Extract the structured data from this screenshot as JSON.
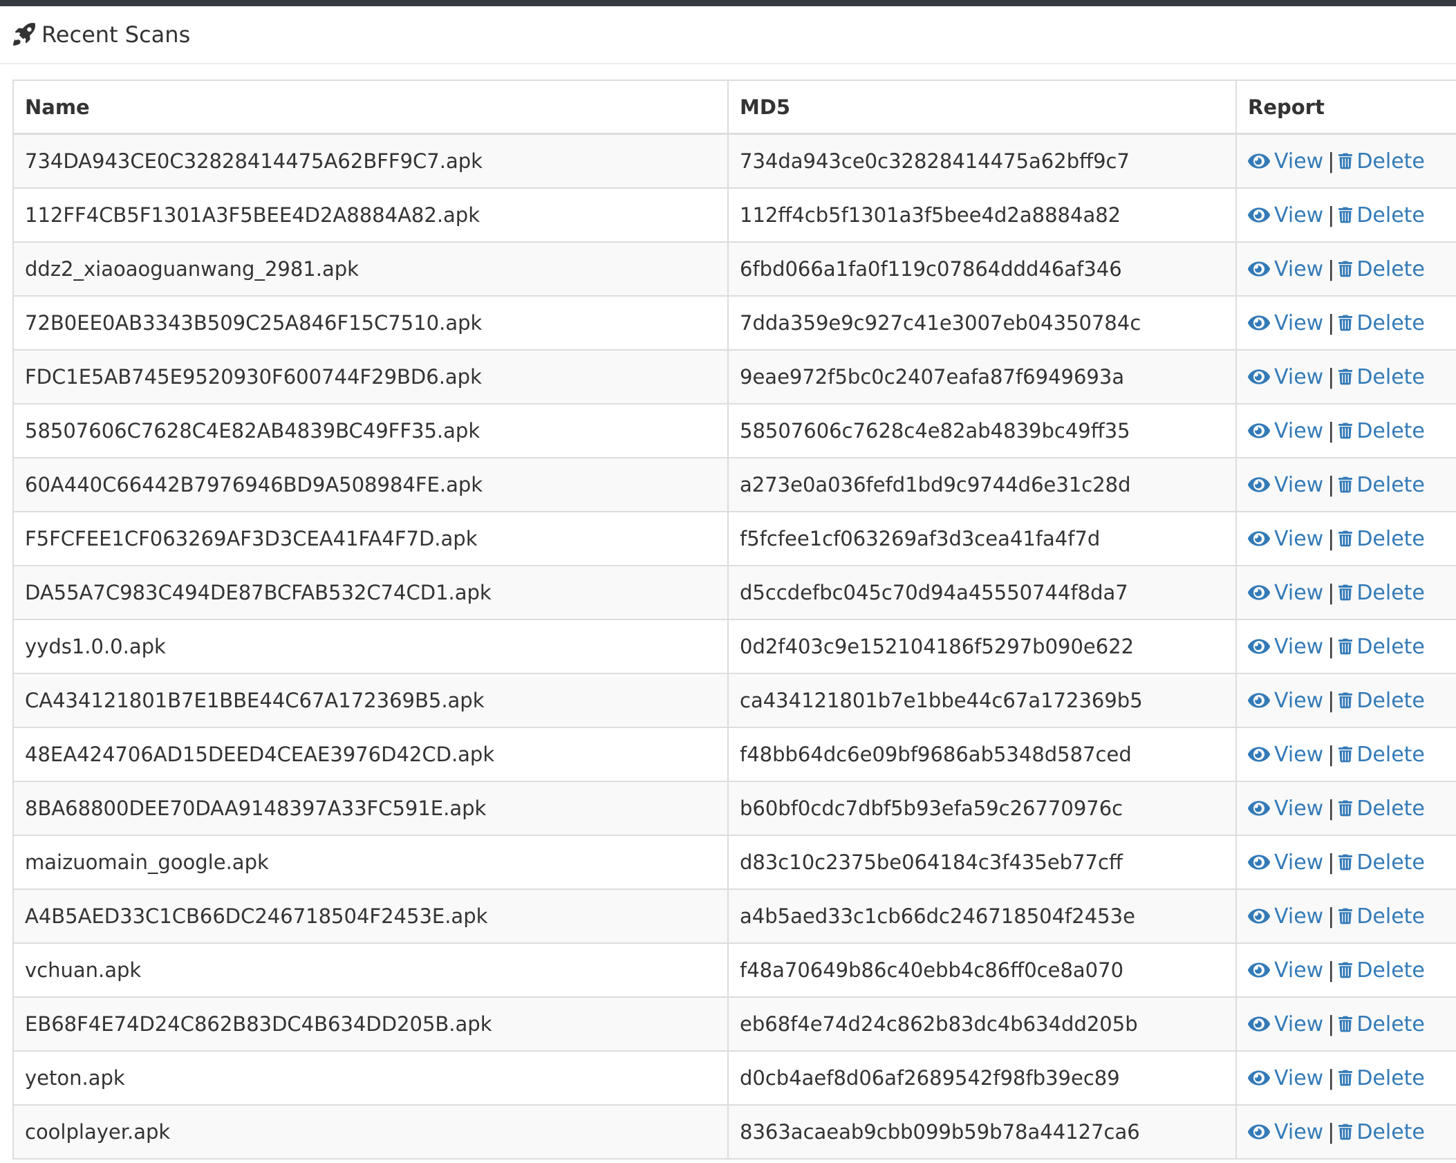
{
  "panel": {
    "title": "Recent Scans",
    "icon": "rocket-icon"
  },
  "table": {
    "headers": [
      "Name",
      "MD5",
      "Report"
    ],
    "action_labels": {
      "view": "View",
      "delete": "Delete",
      "separator": "|"
    },
    "rows": [
      {
        "name": "734DA943CE0C32828414475A62BFF9C7.apk",
        "md5": "734da943ce0c32828414475a62bff9c7"
      },
      {
        "name": "112FF4CB5F1301A3F5BEE4D2A8884A82.apk",
        "md5": "112ff4cb5f1301a3f5bee4d2a8884a82"
      },
      {
        "name": "ddz2_xiaoaoguanwang_2981.apk",
        "md5": "6fbd066a1fa0f119c07864ddd46af346"
      },
      {
        "name": "72B0EE0AB3343B509C25A846F15C7510.apk",
        "md5": "7dda359e9c927c41e3007eb04350784c"
      },
      {
        "name": "FDC1E5AB745E9520930F600744F29BD6.apk",
        "md5": "9eae972f5bc0c2407eafa87f6949693a"
      },
      {
        "name": "58507606C7628C4E82AB4839BC49FF35.apk",
        "md5": "58507606c7628c4e82ab4839bc49ff35"
      },
      {
        "name": "60A440C66442B7976946BD9A508984FE.apk",
        "md5": "a273e0a036fefd1bd9c9744d6e31c28d"
      },
      {
        "name": "F5FCFEE1CF063269AF3D3CEA41FA4F7D.apk",
        "md5": "f5fcfee1cf063269af3d3cea41fa4f7d"
      },
      {
        "name": "DA55A7C983C494DE87BCFAB532C74CD1.apk",
        "md5": "d5ccdefbc045c70d94a45550744f8da7"
      },
      {
        "name": "yyds1.0.0.apk",
        "md5": "0d2f403c9e152104186f5297b090e622"
      },
      {
        "name": "CA434121801B7E1BBE44C67A172369B5.apk",
        "md5": "ca434121801b7e1bbe44c67a172369b5"
      },
      {
        "name": "48EA424706AD15DEED4CEAE3976D42CD.apk",
        "md5": "f48bb64dc6e09bf9686ab5348d587ced"
      },
      {
        "name": "8BA68800DEE70DAA9148397A33FC591E.apk",
        "md5": "b60bf0cdc7dbf5b93efa59c26770976c"
      },
      {
        "name": "maizuomain_google.apk",
        "md5": "d83c10c2375be064184c3f435eb77cff"
      },
      {
        "name": "A4B5AED33C1CB66DC246718504F2453E.apk",
        "md5": "a4b5aed33c1cb66dc246718504f2453e"
      },
      {
        "name": "vchuan.apk",
        "md5": "f48a70649b86c40ebb4c86ff0ce8a070"
      },
      {
        "name": "EB68F4E74D24C862B83DC4B634DD205B.apk",
        "md5": "eb68f4e74d24c862b83dc4b634dd205b"
      },
      {
        "name": "yeton.apk",
        "md5": "d0cb4aef8d06af2689542f98fb39ec89"
      },
      {
        "name": "coolplayer.apk",
        "md5": "8363acaeab9cbb099b59b78a44127ca6"
      }
    ]
  },
  "colors": {
    "link": "#337ab7",
    "topbar": "#343a40",
    "stripe": "#f9f9f9",
    "border": "#dddddd"
  }
}
